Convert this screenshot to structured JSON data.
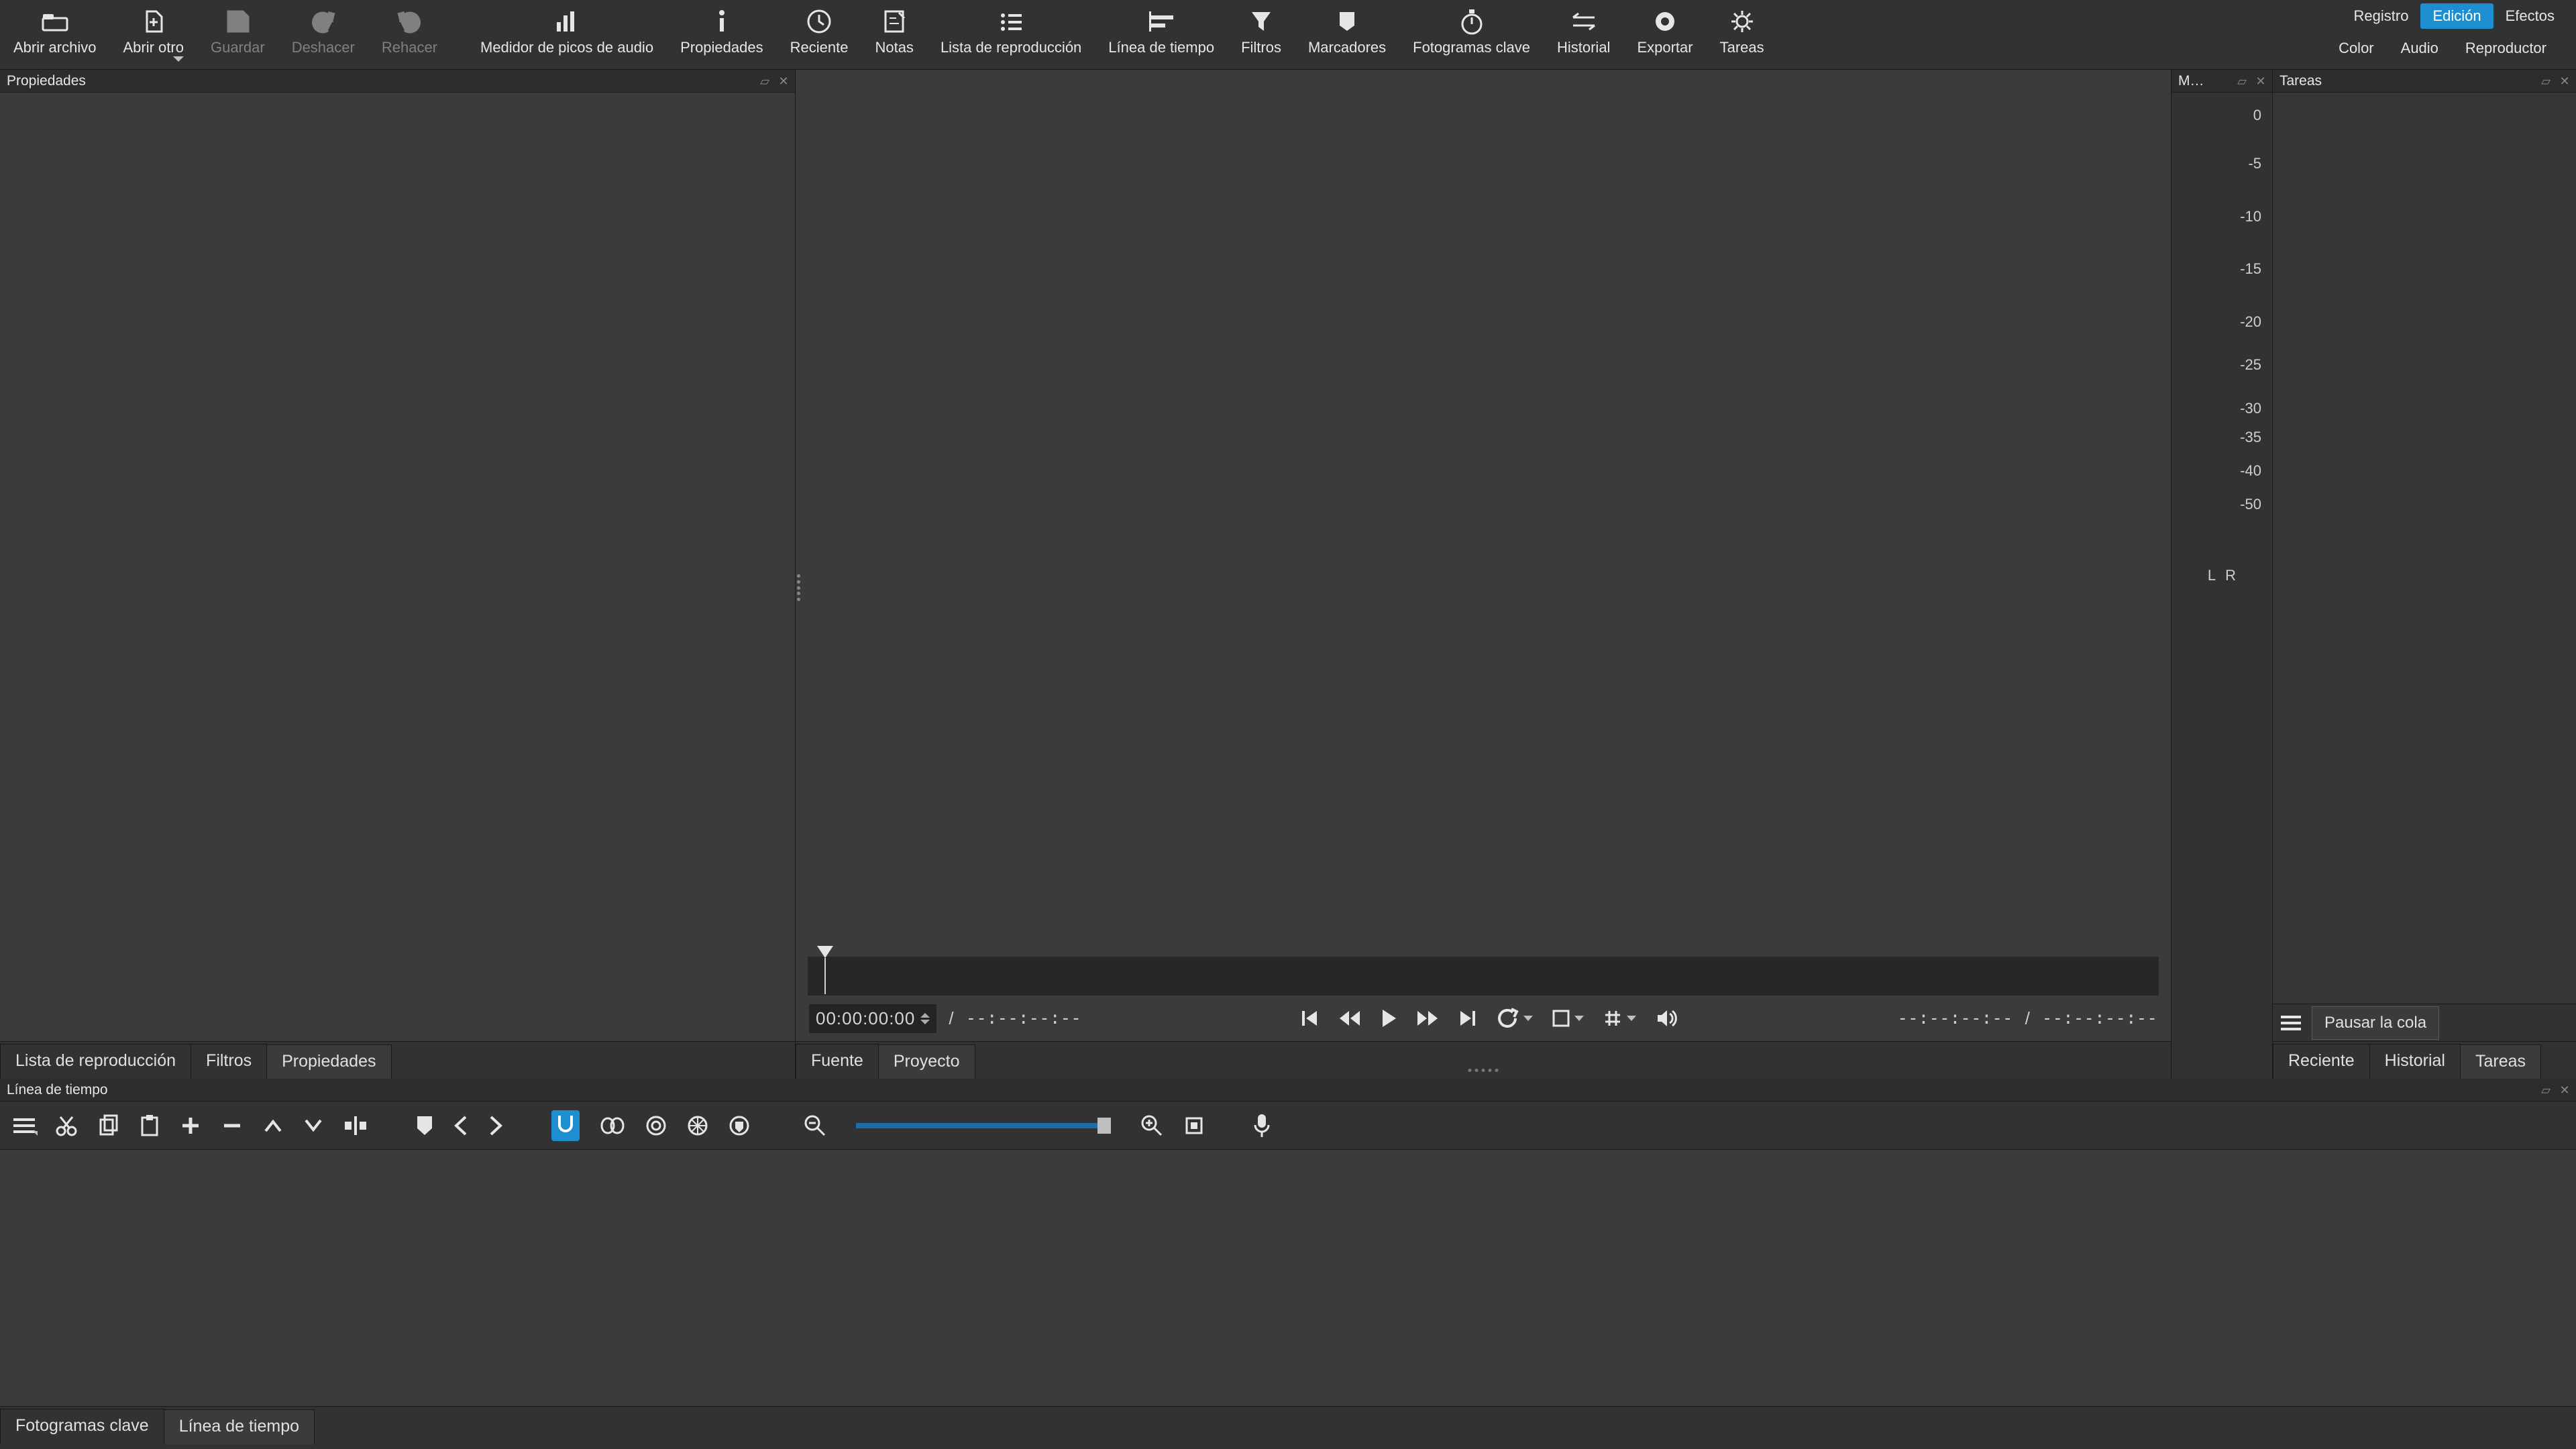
{
  "toolbar": {
    "open": "Abrir archivo",
    "open_other": "Abrir otro",
    "save": "Guardar",
    "undo": "Deshacer",
    "redo": "Rehacer",
    "peak": "Medidor de picos de audio",
    "props": "Propiedades",
    "recent": "Reciente",
    "notes": "Notas",
    "playlist": "Lista de reproducción",
    "timeline": "Línea de tiempo",
    "filters": "Filtros",
    "markers": "Marcadores",
    "keyframes": "Fotogramas clave",
    "history": "Historial",
    "export": "Exportar",
    "jobs": "Tareas"
  },
  "layout_tabs": {
    "logging": "Registro",
    "editing": "Edición",
    "effects": "Efectos",
    "active": "editing"
  },
  "extra_tabs": {
    "color": "Color",
    "audio": "Audio",
    "player": "Reproductor"
  },
  "panels": {
    "properties_title": "Propiedades",
    "meter_title": "M…",
    "tasks_title": "Tareas",
    "timeline_title": "Línea de tiempo"
  },
  "left_bottom_tabs": {
    "playlist": "Lista de reproducción",
    "filters": "Filtros",
    "properties": "Propiedades",
    "active": "properties"
  },
  "player": {
    "timecode": "00:00:00:00",
    "duration": "--:--:--:--",
    "in_point": "--:--:--:--",
    "out_point": "--:--:--:--",
    "tabs": {
      "source": "Fuente",
      "project": "Proyecto",
      "active": "project"
    }
  },
  "meter": {
    "ticks": [
      {
        "v": "0",
        "pct": 3
      },
      {
        "v": "-5",
        "pct": 13
      },
      {
        "v": "-10",
        "pct": 24
      },
      {
        "v": "-15",
        "pct": 35
      },
      {
        "v": "-20",
        "pct": 46
      },
      {
        "v": "-25",
        "pct": 55
      },
      {
        "v": "-30",
        "pct": 64
      },
      {
        "v": "-35",
        "pct": 70
      },
      {
        "v": "-40",
        "pct": 77
      },
      {
        "v": "-50",
        "pct": 84
      }
    ],
    "L": "L",
    "R": "R"
  },
  "tasks": {
    "pause_btn": "Pausar la cola",
    "tabs": {
      "recent": "Reciente",
      "history": "Historial",
      "jobs": "Tareas",
      "active": "jobs"
    }
  },
  "timeline_tabs": {
    "keyframes": "Fotogramas clave",
    "timeline": "Línea de tiempo",
    "active": "timeline"
  }
}
